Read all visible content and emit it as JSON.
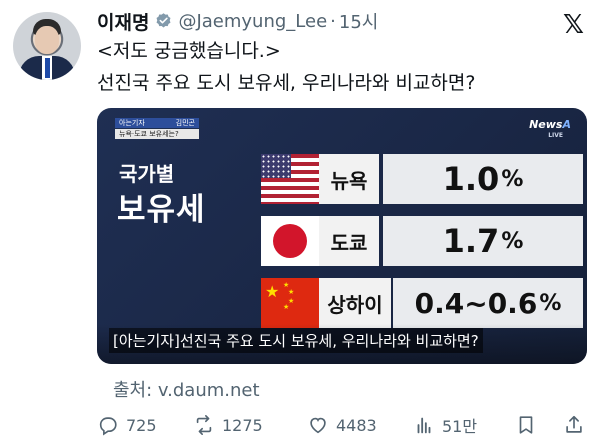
{
  "author": {
    "name": "이재명",
    "handle": "@Jaemyung_Lee",
    "separator": "·",
    "time": "15시"
  },
  "brand": {
    "logo": "𝕏"
  },
  "tweet": {
    "line1": "<저도 궁금했습니다.>",
    "line2": "선진국 주요 도시 보유세, 우리나라와 비교하면?"
  },
  "media": {
    "reporter_tag": "아는기자",
    "reporter_name": "김민곤",
    "reporter_subtitle": "뉴욕·도쿄 보유세는?",
    "network": "News",
    "network_accent": "A",
    "live": "LIVE",
    "label_small": "국가별",
    "label_big": "보유세",
    "rows": [
      {
        "city": "뉴욕",
        "value": "1.0",
        "unit": "%",
        "flag": "us-flag-icon"
      },
      {
        "city": "도쿄",
        "value": "1.7",
        "unit": "%",
        "flag": "japan-flag-icon"
      },
      {
        "city": "상하이",
        "value": "0.4~0.6",
        "unit": "%",
        "flag": "china-flag-icon"
      }
    ],
    "caption": "[아는기자]선진국 주요 도시 보유세, 우리나라와 비교하면?"
  },
  "source": "출처: v.daum.net",
  "actions": {
    "replies": "725",
    "reposts": "1275",
    "likes": "4483",
    "views": "51만"
  },
  "colors": {
    "text": "#0f1419",
    "muted": "#536471",
    "verified": "#829aab",
    "card_bg": "#1f2f53"
  }
}
